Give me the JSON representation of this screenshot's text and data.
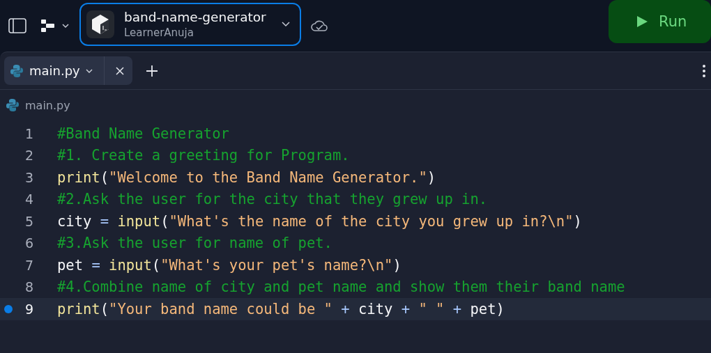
{
  "header": {
    "repl_name": "band-name-generator",
    "owner": "LearnerAnuja",
    "run_label": "Run"
  },
  "tabs": [
    {
      "label": "main.py",
      "selected": true
    }
  ],
  "breadcrumb": "main.py",
  "code": [
    {
      "number": "1",
      "active": false,
      "tokens": [
        {
          "kind": "comment",
          "text": "#Band Name Generator"
        }
      ]
    },
    {
      "number": "2",
      "active": false,
      "tokens": [
        {
          "kind": "comment",
          "text": "#1. Create a greeting for Program."
        }
      ]
    },
    {
      "number": "3",
      "active": false,
      "tokens": [
        {
          "kind": "func",
          "text": "print"
        },
        {
          "kind": "plain",
          "text": "("
        },
        {
          "kind": "string",
          "text": "\"Welcome to the Band Name Generator.\""
        },
        {
          "kind": "plain",
          "text": ")"
        }
      ]
    },
    {
      "number": "4",
      "active": false,
      "tokens": [
        {
          "kind": "comment",
          "text": "#2.Ask the user for the city that they grew up in."
        }
      ]
    },
    {
      "number": "5",
      "active": false,
      "tokens": [
        {
          "kind": "plain",
          "text": "city "
        },
        {
          "kind": "op",
          "text": "= "
        },
        {
          "kind": "func",
          "text": "input"
        },
        {
          "kind": "plain",
          "text": "("
        },
        {
          "kind": "string",
          "text": "\"What's the name of the city you grew up in?\\n\""
        },
        {
          "kind": "plain",
          "text": ")"
        }
      ]
    },
    {
      "number": "6",
      "active": false,
      "tokens": [
        {
          "kind": "comment",
          "text": "#3.Ask the user for name of pet."
        }
      ]
    },
    {
      "number": "7",
      "active": false,
      "tokens": [
        {
          "kind": "plain",
          "text": "pet "
        },
        {
          "kind": "op",
          "text": "= "
        },
        {
          "kind": "func",
          "text": "input"
        },
        {
          "kind": "plain",
          "text": "("
        },
        {
          "kind": "string",
          "text": "\"What's your pet's name?\\n\""
        },
        {
          "kind": "plain",
          "text": ")"
        }
      ]
    },
    {
      "number": "8",
      "active": false,
      "tokens": [
        {
          "kind": "comment",
          "text": "#4.Combine name of city and pet name and show them their band name"
        }
      ]
    },
    {
      "number": "9",
      "active": true,
      "tokens": [
        {
          "kind": "func",
          "text": "print"
        },
        {
          "kind": "plain",
          "text": "("
        },
        {
          "kind": "string",
          "text": "\"Your band name could be \""
        },
        {
          "kind": "op",
          "text": " + "
        },
        {
          "kind": "plain",
          "text": "city"
        },
        {
          "kind": "op",
          "text": " + "
        },
        {
          "kind": "string",
          "text": "\" \""
        },
        {
          "kind": "op",
          "text": " + "
        },
        {
          "kind": "plain",
          "text": "pet)"
        }
      ]
    }
  ]
}
